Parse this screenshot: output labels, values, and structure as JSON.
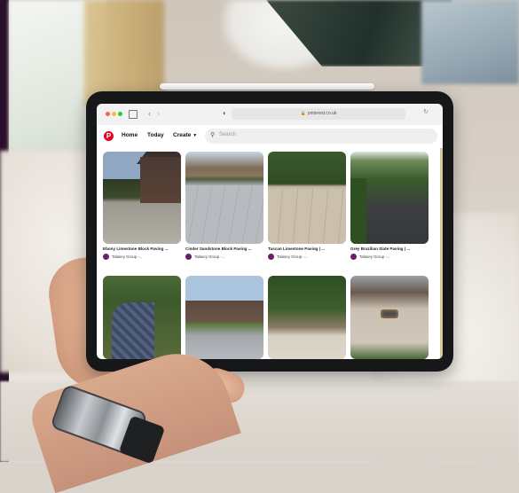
{
  "browser": {
    "url": "pinterest.co.uk"
  },
  "pinterest": {
    "logo": "P",
    "nav": {
      "home": "Home",
      "today": "Today",
      "create": "Create"
    },
    "search_placeholder": "Search"
  },
  "pins": [
    {
      "title": "Ebony Limestone Block Paving ...",
      "author": "Talasey Group -..."
    },
    {
      "title": "Cinder Sandstone Block Paving ...",
      "author": "Talasey Group -..."
    },
    {
      "title": "Tuscan Limestone Paving | ...",
      "author": "Talasey Group -..."
    },
    {
      "title": "Grey Brazilian Slate Paving | ...",
      "author": "Talasey Group -..."
    },
    {
      "title": "",
      "author": ""
    },
    {
      "title": "",
      "author": ""
    },
    {
      "title": "",
      "author": ""
    },
    {
      "title": "",
      "author": ""
    }
  ],
  "colors": {
    "pinterest_red": "#e60023",
    "author_logo": "#6a1f6a"
  },
  "icons": [
    "sidebar-icon",
    "back-arrow-icon",
    "forward-arrow-icon",
    "shield-icon",
    "lock-icon",
    "reload-icon",
    "search-icon",
    "chevron-down-icon"
  ]
}
